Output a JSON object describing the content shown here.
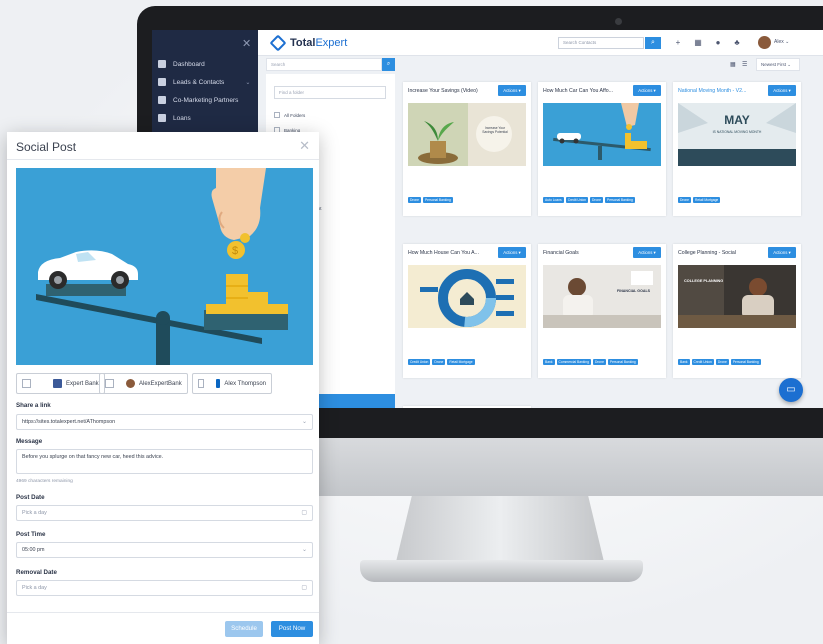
{
  "app": {
    "logo_total": "Total",
    "logo_expert": "Expert",
    "header_search_placeholder": "Search Contacts",
    "user_name": "Alex",
    "sub_search_placeholder": "Search",
    "sort_label": "Newest First",
    "folder_search_placeholder": "Find a folder",
    "folders": [
      "All Folders",
      "Banking",
      "s",
      "Ment Management"
    ],
    "sidebar": [
      {
        "label": "Dashboard",
        "icon": "dashboard-icon"
      },
      {
        "label": "Leads & Contacts",
        "icon": "contacts-icon"
      },
      {
        "label": "Co-Marketing Partners",
        "icon": "partners-icon"
      },
      {
        "label": "Loans",
        "icon": "loans-icon"
      }
    ],
    "cards": [
      {
        "title": "Increase Your Savings (Video)",
        "actions": "Actions",
        "tags": [
          "Drone",
          "Personal Banking"
        ],
        "img_text": "Increase Your Savings Potential"
      },
      {
        "title": "How Much Car Can You Affo...",
        "actions": "Actions",
        "tags": [
          "Auto Loans",
          "Credit Union",
          "Drone",
          "Personal Banking"
        ]
      },
      {
        "title": "National Moving Month - V2...",
        "actions": "Actions",
        "tags": [
          "Drone",
          "Retail Mortgage"
        ],
        "img_text_1": "MAY",
        "img_text_2": "IS NATIONAL MOVING MONTH"
      },
      {
        "title": "How Much House Can You A...",
        "actions": "Actions",
        "tags": [
          "Credit Union",
          "Drone",
          "Retail Mortgage"
        ]
      },
      {
        "title": "Financial Goals",
        "actions": "Actions",
        "tags": [
          "Bank",
          "Commercial Banking",
          "Drone",
          "Personal Banking"
        ],
        "img_text": "FINANCIAL GOALS"
      },
      {
        "title": "College Planning - Social",
        "actions": "Actions",
        "tags": [
          "Bank",
          "Credit Union",
          "Drone",
          "Personal Banking"
        ],
        "img_text": "COLLEGE PLANNING"
      }
    ],
    "colors": {
      "accent": "#2d8ee0",
      "sidebar": "#1f2a44"
    }
  },
  "modal": {
    "title": "Social Post",
    "accounts": [
      {
        "label": "Expert Bank",
        "icon": "facebook-icon"
      },
      {
        "label": "AlexExpertBank",
        "icon": "twitter-icon"
      },
      {
        "label": "Alex Thompson",
        "icon": "linkedin-icon"
      }
    ],
    "share_link_label": "Share a link",
    "share_link_value": "https://sites.totalexpert.net/AThompson",
    "message_label": "Message",
    "message_value": "Before you splurge on that fancy new car, heed this advice.",
    "chars_remaining": "4969 characters remaining",
    "post_date_label": "Post Date",
    "post_date_placeholder": "Pick a day",
    "post_time_label": "Post Time",
    "post_time_value": "05:00 pm",
    "removal_date_label": "Removal Date",
    "removal_date_placeholder": "Pick a day",
    "schedule_button": "Schedule",
    "post_now_button": "Post Now"
  }
}
